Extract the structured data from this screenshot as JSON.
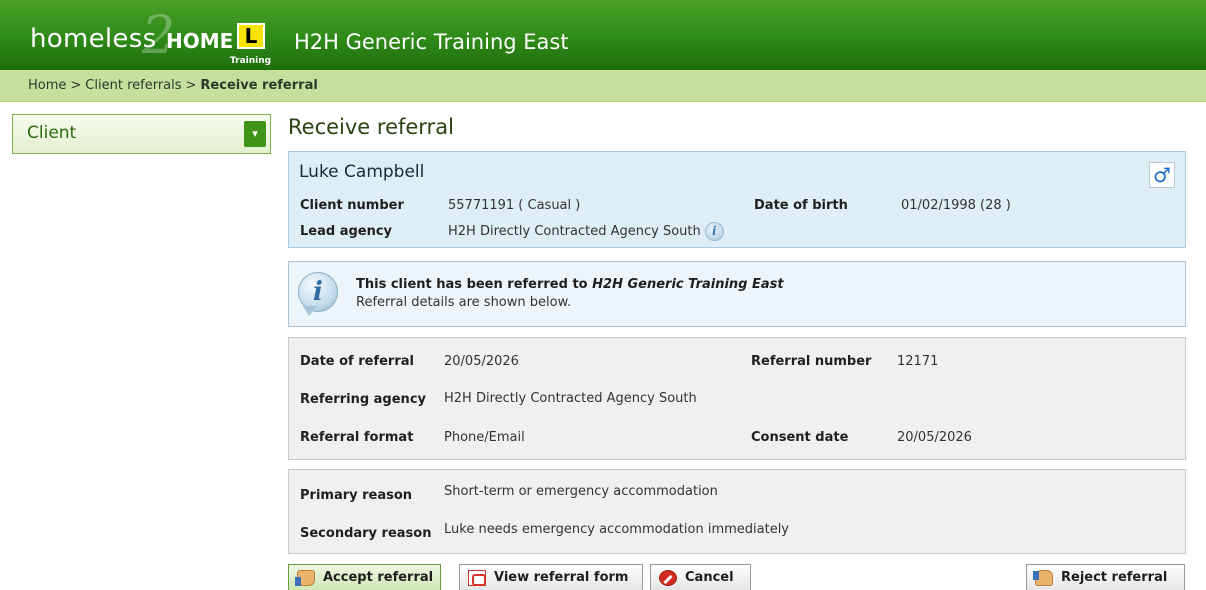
{
  "header": {
    "logo_homeless": "homeless",
    "logo_two": "2",
    "logo_home": "HOME",
    "logo_training": "Training",
    "l_plate": "L",
    "app_title": "H2H Generic Training East",
    "colors": {
      "header_green": "#2e8a17",
      "breadcrumb_green": "#c5df9f"
    }
  },
  "breadcrumb": {
    "items": [
      "Home",
      "Client referrals"
    ],
    "separator": ">",
    "current": "Receive referral"
  },
  "side_menu": {
    "label": "Client",
    "toggle_icon": "chevron-down-icon"
  },
  "page": {
    "title": "Receive referral"
  },
  "client": {
    "name": "Luke Campbell",
    "gender_icon": "male-icon",
    "gender_symbol": "♂",
    "client_number_label": "Client number",
    "client_number_value": "55771191 ( Casual )",
    "date_of_birth_label": "Date of birth",
    "date_of_birth_value": "01/02/1998 (28 )",
    "lead_agency_label": "Lead agency",
    "lead_agency_value": "H2H Directly Contracted Agency South",
    "info_glyph": "i"
  },
  "notice": {
    "line1_prefix": "This client has been referred to ",
    "line1_agency": "H2H Generic Training East",
    "line2": "Referral details are shown below.",
    "icon_glyph": "i"
  },
  "referral": {
    "date_label": "Date of referral",
    "date_value": "20/05/2026",
    "number_label": "Referral number",
    "number_value": "12171",
    "agency_label": "Referring agency",
    "agency_value": "H2H Directly Contracted Agency South",
    "format_label": "Referral format",
    "format_value": "Phone/Email",
    "consent_label": "Consent date",
    "consent_value": "20/05/2026"
  },
  "reasons": {
    "primary_label": "Primary reason",
    "primary_value": "Short-term or emergency accommodation",
    "secondary_label": "Secondary reason",
    "secondary_value": "Luke needs emergency accommodation immediately"
  },
  "actions": {
    "accept": "Accept referral",
    "view_form": "View referral form",
    "cancel": "Cancel",
    "reject": "Reject referral"
  }
}
